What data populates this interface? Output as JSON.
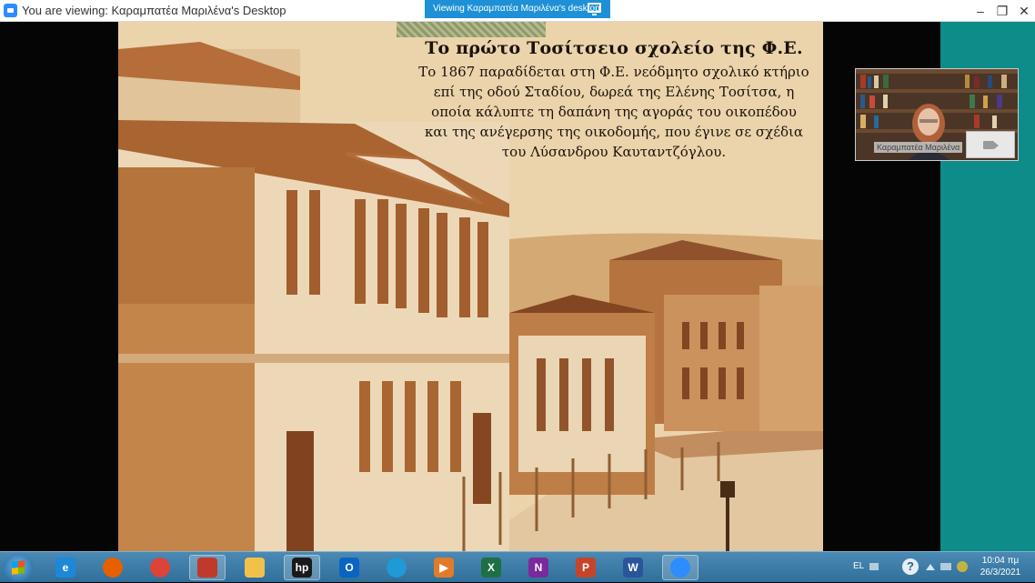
{
  "window": {
    "title": "You are viewing: Καραμπατέα Μαριλένα's Desktop",
    "viewing_banner": "Viewing Καραμπατέα Μαριλένα's desktop",
    "minimize": "–",
    "restore": "❐",
    "close": "✕"
  },
  "slide": {
    "title": "Το πρώτο Τοσίτσειο σχολείο της Φ.Ε.",
    "body_lines": [
      "Το 1867 παραδίδεται στη Φ.Ε. νεόδμητο σχολικό κτήριο",
      "επί της οδού Σταδίου, δωρεά της Ελένης Τοσίτσα, η",
      "οποία κάλυπτε τη δαπάνη της αγοράς του οικοπέδου",
      "και της ανέγερσης της οικοδομής, που έγινε σε σχέδια",
      "του Λύσανδρου Καυταντζόγλου."
    ]
  },
  "video": {
    "participant_name": "Καραμπατέα Μαριλένα"
  },
  "taskbar": {
    "apps": [
      {
        "name": "internet-explorer",
        "glyph": "e",
        "color": "#1e88d8"
      },
      {
        "name": "firefox",
        "glyph": "",
        "color": "#e66000"
      },
      {
        "name": "chrome",
        "glyph": "",
        "color": "#db4437"
      },
      {
        "name": "zoom-app",
        "glyph": "",
        "color": "#c0392b"
      },
      {
        "name": "file-explorer",
        "glyph": "",
        "color": "#f0c24a"
      },
      {
        "name": "hp-app",
        "glyph": "hp",
        "color": "#1a1a1a"
      },
      {
        "name": "outlook",
        "glyph": "O",
        "color": "#0a64c2"
      },
      {
        "name": "edge",
        "glyph": "",
        "color": "#1f9ad6"
      },
      {
        "name": "media-player",
        "glyph": "▶",
        "color": "#e07b2a"
      },
      {
        "name": "excel",
        "glyph": "X",
        "color": "#1d7044"
      },
      {
        "name": "onenote",
        "glyph": "N",
        "color": "#7a2a9c"
      },
      {
        "name": "powerpoint",
        "glyph": "P",
        "color": "#c7442a"
      },
      {
        "name": "word",
        "glyph": "W",
        "color": "#2a5699"
      },
      {
        "name": "zoom-meeting",
        "glyph": "",
        "color": "#2d8cff"
      }
    ],
    "language": "EL",
    "help": "?",
    "time": "10:04 πμ",
    "date": "26/3/2021"
  }
}
